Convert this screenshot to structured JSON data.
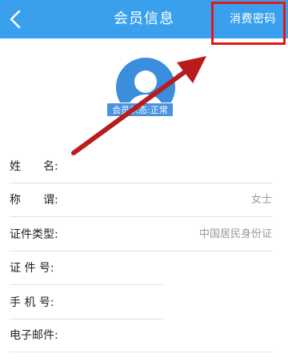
{
  "header": {
    "title": "会员信息",
    "right_button": "消费密码"
  },
  "avatar": {
    "status_label": "会员状态:正常"
  },
  "form": {
    "rows": [
      {
        "label": "姓　　名:",
        "value": ""
      },
      {
        "label": "称　　谓:",
        "value": "女士"
      },
      {
        "label": "证件类型:",
        "value": "中国居民身份证"
      },
      {
        "label": "证 件 号:",
        "value": ""
      },
      {
        "label": "手 机 号:",
        "value": ""
      },
      {
        "label": "电子邮件:",
        "value": ""
      }
    ]
  },
  "colors": {
    "header_bg": "#3aa0ee",
    "annotation": "#e01a1a",
    "avatar": "#3b8ede"
  }
}
